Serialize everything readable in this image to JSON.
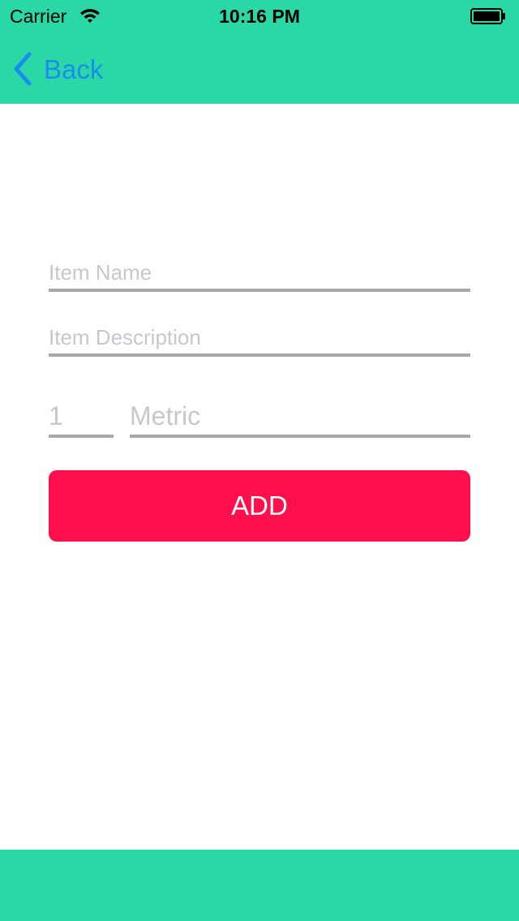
{
  "status_bar": {
    "carrier": "Carrier",
    "time": "10:16 PM",
    "wifi_icon": "wifi-icon",
    "battery_icon": "battery-icon"
  },
  "nav": {
    "back_label": "Back",
    "back_icon": "chevron-left-icon"
  },
  "form": {
    "item_name": {
      "placeholder": "Item Name",
      "value": ""
    },
    "item_description": {
      "placeholder": "Item Description",
      "value": ""
    },
    "quantity": {
      "placeholder": "1",
      "value": ""
    },
    "metric": {
      "placeholder": "Metric",
      "value": ""
    },
    "add_label": "ADD"
  },
  "colors": {
    "bar_background": "#2ad8a6",
    "back_tint": "#1a8cf0",
    "add_button": "#ff0f4b",
    "field_underline": "#a9a9a9",
    "placeholder": "#c7c7cd"
  }
}
